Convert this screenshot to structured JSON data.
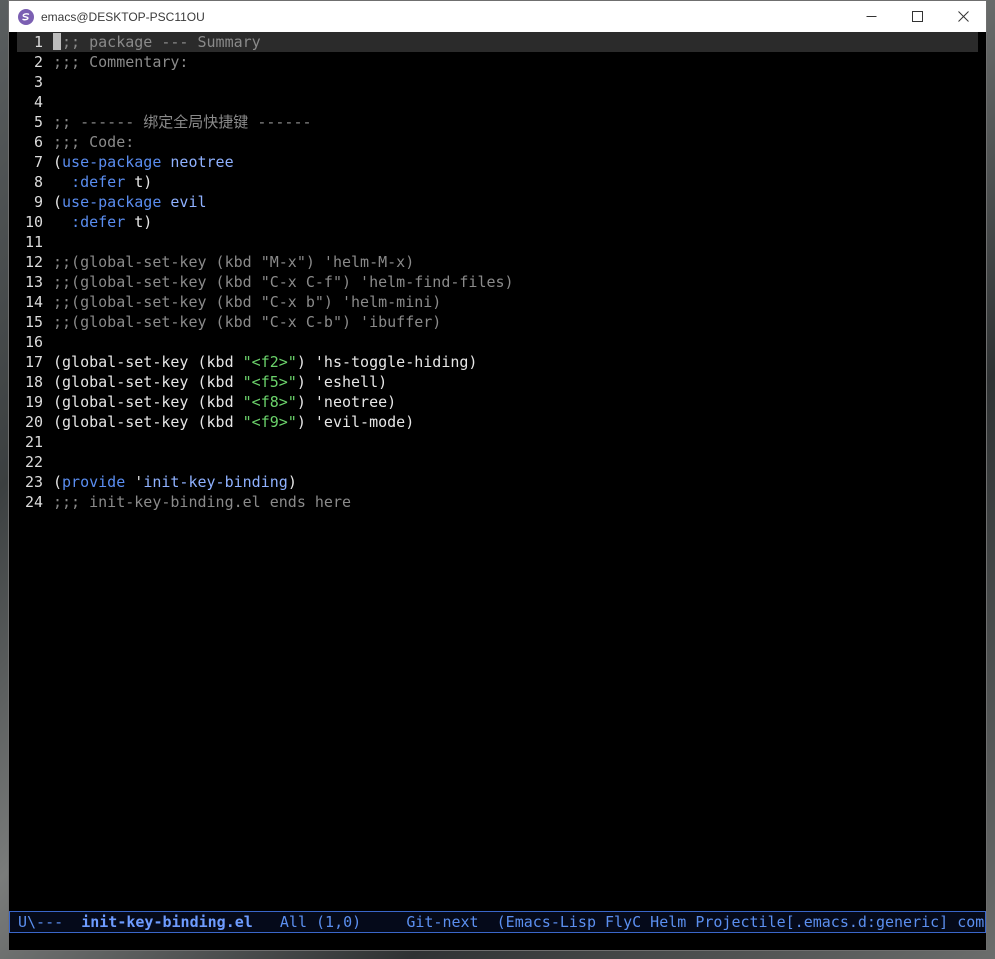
{
  "window": {
    "title": "emacs@DESKTOP-PSC11OU",
    "controls": {
      "minimize_icon": "minimize-icon",
      "maximize_icon": "maximize-icon",
      "close_icon": "close-icon"
    }
  },
  "editor": {
    "lines": [
      {
        "num": "1",
        "tokens": [
          {
            "t": ";;; package --- Summary",
            "c": "comment"
          }
        ]
      },
      {
        "num": "2",
        "tokens": [
          {
            "t": ";;; Commentary:",
            "c": "comment"
          }
        ]
      },
      {
        "num": "3",
        "tokens": []
      },
      {
        "num": "4",
        "tokens": []
      },
      {
        "num": "5",
        "tokens": [
          {
            "t": ";; ------ 绑定全局快捷键 ------",
            "c": "comment"
          }
        ]
      },
      {
        "num": "6",
        "tokens": [
          {
            "t": ";;; Code:",
            "c": "comment"
          }
        ]
      },
      {
        "num": "7",
        "tokens": [
          {
            "t": "(",
            "c": "plain"
          },
          {
            "t": "use-package",
            "c": "keyword"
          },
          {
            "t": " ",
            "c": "plain"
          },
          {
            "t": "neotree",
            "c": "func"
          }
        ]
      },
      {
        "num": "8",
        "tokens": [
          {
            "t": "  ",
            "c": "plain"
          },
          {
            "t": ":defer",
            "c": "builtin"
          },
          {
            "t": " t)",
            "c": "plain"
          }
        ]
      },
      {
        "num": "9",
        "tokens": [
          {
            "t": "(",
            "c": "plain"
          },
          {
            "t": "use-package",
            "c": "keyword"
          },
          {
            "t": " ",
            "c": "plain"
          },
          {
            "t": "evil",
            "c": "func"
          }
        ]
      },
      {
        "num": "10",
        "tokens": [
          {
            "t": "  ",
            "c": "plain"
          },
          {
            "t": ":defer",
            "c": "builtin"
          },
          {
            "t": " t)",
            "c": "plain"
          }
        ]
      },
      {
        "num": "11",
        "tokens": []
      },
      {
        "num": "12",
        "tokens": [
          {
            "t": ";;(global-set-key (kbd \"M-x\") 'helm-M-x)",
            "c": "comment"
          }
        ]
      },
      {
        "num": "13",
        "tokens": [
          {
            "t": ";;(global-set-key (kbd \"C-x C-f\") 'helm-find-files)",
            "c": "comment"
          }
        ]
      },
      {
        "num": "14",
        "tokens": [
          {
            "t": ";;(global-set-key (kbd \"C-x b\") 'helm-mini)",
            "c": "comment"
          }
        ]
      },
      {
        "num": "15",
        "tokens": [
          {
            "t": ";;(global-set-key (kbd \"C-x C-b\") 'ibuffer)",
            "c": "comment"
          }
        ]
      },
      {
        "num": "16",
        "tokens": []
      },
      {
        "num": "17",
        "tokens": [
          {
            "t": "(global-set-key (kbd ",
            "c": "plain"
          },
          {
            "t": "\"<f2>\"",
            "c": "string"
          },
          {
            "t": ") 'hs-toggle-hiding)",
            "c": "plain"
          }
        ]
      },
      {
        "num": "18",
        "tokens": [
          {
            "t": "(global-set-key (kbd ",
            "c": "plain"
          },
          {
            "t": "\"<f5>\"",
            "c": "string"
          },
          {
            "t": ") 'eshell)",
            "c": "plain"
          }
        ]
      },
      {
        "num": "19",
        "tokens": [
          {
            "t": "(global-set-key (kbd ",
            "c": "plain"
          },
          {
            "t": "\"<f8>\"",
            "c": "string"
          },
          {
            "t": ") 'neotree)",
            "c": "plain"
          }
        ]
      },
      {
        "num": "20",
        "tokens": [
          {
            "t": "(global-set-key (kbd ",
            "c": "plain"
          },
          {
            "t": "\"<f9>\"",
            "c": "string"
          },
          {
            "t": ") 'evil-mode)",
            "c": "plain"
          }
        ]
      },
      {
        "num": "21",
        "tokens": []
      },
      {
        "num": "22",
        "tokens": []
      },
      {
        "num": "23",
        "tokens": [
          {
            "t": "(",
            "c": "plain"
          },
          {
            "t": "provide",
            "c": "keyword"
          },
          {
            "t": " '",
            "c": "plain"
          },
          {
            "t": "init-key-binding",
            "c": "func"
          },
          {
            "t": ")",
            "c": "plain"
          }
        ]
      },
      {
        "num": "24",
        "tokens": [
          {
            "t": ";;; init-key-binding.el ends here",
            "c": "comment"
          }
        ]
      }
    ],
    "cursor_line": 1
  },
  "modeline": {
    "status": "U\\---  ",
    "buffer_name": "init-key-binding.el",
    "position": "   All (1,0)     ",
    "vc": "Git-next  ",
    "modes": "(Emacs-Lisp FlyC Helm Projectile[.emacs.d:generic] comp"
  },
  "colors": {
    "background": "#000000",
    "comment": "#8a8a8a",
    "keyword": "#5a8df0",
    "string": "#6bd26b",
    "modeline_fg": "#5b8ff0",
    "modeline_border": "#3a66c9",
    "title_icon": "#7b5fb2"
  }
}
